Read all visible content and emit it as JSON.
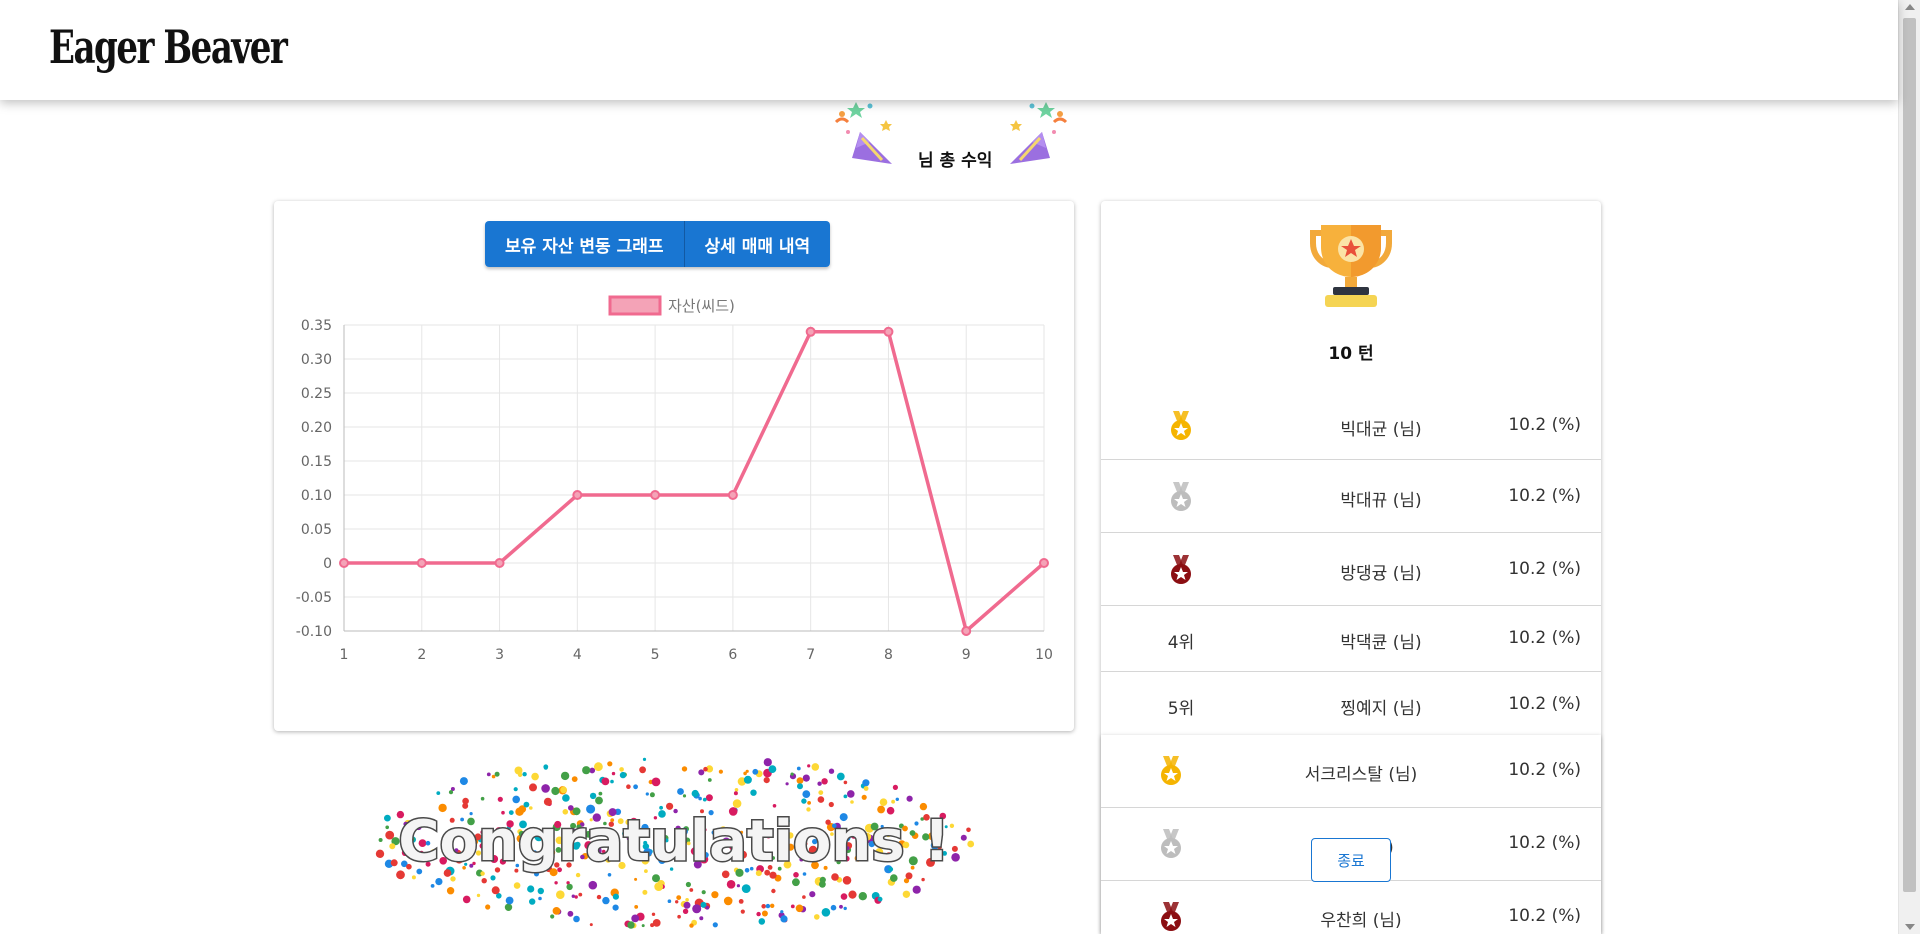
{
  "header": {
    "logo": "Eager Beaver"
  },
  "hero": {
    "title": "님 총 수익"
  },
  "chart_panel": {
    "tabs": [
      {
        "label": "보유 자산 변동 그래프"
      },
      {
        "label": "상세 매매 내역"
      }
    ]
  },
  "chart_data": {
    "type": "line",
    "x": [
      1,
      2,
      3,
      4,
      5,
      6,
      7,
      8,
      9,
      10
    ],
    "series": [
      {
        "name": "자산(씨드)",
        "values": [
          0,
          0,
          0,
          0.1,
          0.1,
          0.1,
          0.34,
          0.34,
          -0.1,
          0
        ]
      }
    ],
    "xlabel": "",
    "ylabel": "",
    "ylim": [
      -0.1,
      0.35
    ],
    "yticks": [
      "0.35",
      "0.30",
      "0.25",
      "0.20",
      "0.15",
      "0.10",
      "0.05",
      "0",
      "-0.05",
      "-0.10"
    ],
    "xticks": [
      "1",
      "2",
      "3",
      "4",
      "5",
      "6",
      "7",
      "8",
      "9",
      "10"
    ],
    "grid": true,
    "legend": "top-center",
    "colors": {
      "line": "#f06a8f",
      "fill": "#f4a3b7"
    }
  },
  "ranking": {
    "turn_label": "10 턴",
    "rows": [
      {
        "rank": "",
        "medal": "gold-medal-icon",
        "name": "빅대균 (님)",
        "pct": "10.2 (%)"
      },
      {
        "rank": "",
        "medal": "silver-medal-icon",
        "name": "박대뀨 (님)",
        "pct": "10.2 (%)"
      },
      {
        "rank": "",
        "medal": "bronze-medal-icon",
        "name": "방댕귱 (님)",
        "pct": "10.2 (%)"
      },
      {
        "rank": "4위",
        "medal": "",
        "name": "박댁큔 (님)",
        "pct": "10.2 (%)"
      },
      {
        "rank": "5위",
        "medal": "",
        "name": "찡예지 (님)",
        "pct": "10.2 (%)"
      }
    ]
  },
  "overlay_ranking": {
    "rows": [
      {
        "medal": "gold-medal-icon",
        "name": "서크리스탈 (님)",
        "pct": "10.2 (%)"
      },
      {
        "medal": "silver-medal-icon",
        "name": "우뚱 (님)",
        "pct": "10.2 (%)"
      },
      {
        "medal": "bronze-medal-icon",
        "name": "우찬희 (님)",
        "pct": "10.2 (%)"
      }
    ],
    "close_label": "종료"
  },
  "congrats": {
    "text": "Congratulations !"
  },
  "colors": {
    "primary": "#1976d2",
    "gold": "#f5b400",
    "silver": "#bdbdbd",
    "bronze": "#8b0e12"
  }
}
